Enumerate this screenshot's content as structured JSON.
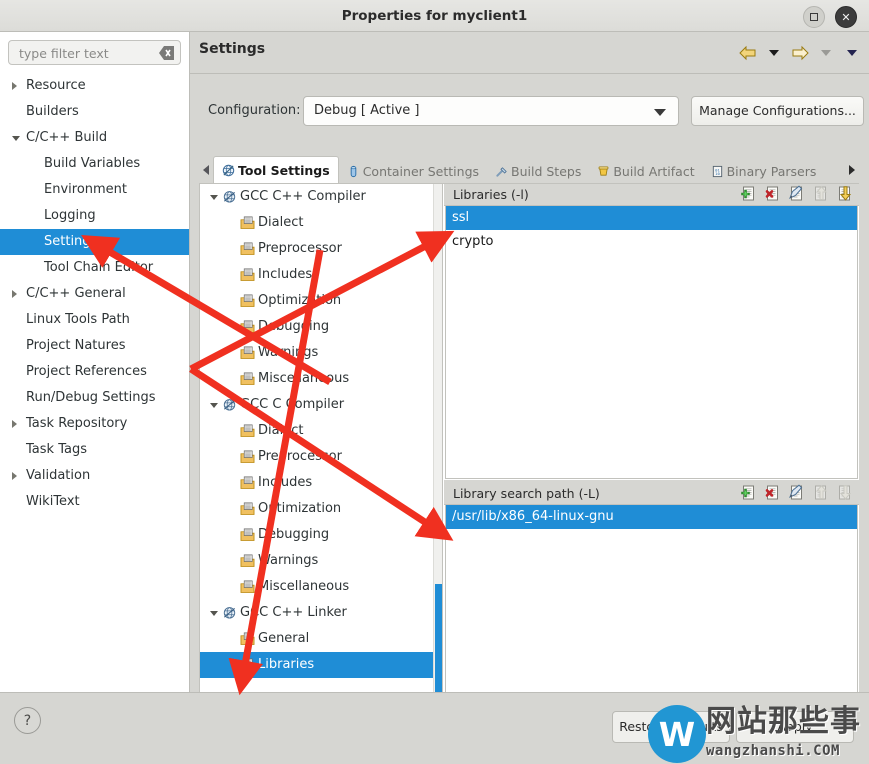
{
  "window": {
    "title": "Properties for myclient1",
    "maximize_label": "Maximize",
    "close_label": "Close"
  },
  "sidebar": {
    "filter": {
      "value": "",
      "placeholder": "type filter text",
      "clear_label": "Clear"
    },
    "items": [
      {
        "label": "Resource",
        "depth": 0,
        "twisty": "collapsed",
        "selected": false
      },
      {
        "label": "Builders",
        "depth": 0,
        "twisty": "none",
        "selected": false
      },
      {
        "label": "C/C++ Build",
        "depth": 0,
        "twisty": "expanded",
        "selected": false
      },
      {
        "label": "Build Variables",
        "depth": 1,
        "twisty": "none",
        "selected": false
      },
      {
        "label": "Environment",
        "depth": 1,
        "twisty": "none",
        "selected": false
      },
      {
        "label": "Logging",
        "depth": 1,
        "twisty": "none",
        "selected": false
      },
      {
        "label": "Settings",
        "depth": 1,
        "twisty": "none",
        "selected": true
      },
      {
        "label": "Tool Chain Editor",
        "depth": 1,
        "twisty": "none",
        "selected": false
      },
      {
        "label": "C/C++ General",
        "depth": 0,
        "twisty": "collapsed",
        "selected": false
      },
      {
        "label": "Linux Tools Path",
        "depth": 0,
        "twisty": "none",
        "selected": false
      },
      {
        "label": "Project Natures",
        "depth": 0,
        "twisty": "none",
        "selected": false
      },
      {
        "label": "Project References",
        "depth": 0,
        "twisty": "none",
        "selected": false
      },
      {
        "label": "Run/Debug Settings",
        "depth": 0,
        "twisty": "none",
        "selected": false
      },
      {
        "label": "Task Repository",
        "depth": 0,
        "twisty": "collapsed",
        "selected": false
      },
      {
        "label": "Task Tags",
        "depth": 0,
        "twisty": "none",
        "selected": false
      },
      {
        "label": "Validation",
        "depth": 0,
        "twisty": "collapsed",
        "selected": false
      },
      {
        "label": "WikiText",
        "depth": 0,
        "twisty": "none",
        "selected": false
      }
    ]
  },
  "page": {
    "title": "Settings",
    "nav": {
      "back_label": "Back",
      "back_menu_label": "Back history",
      "forward_label": "Forward",
      "forward_menu_label": "Forward history",
      "view_menu_label": "View menu"
    }
  },
  "configuration": {
    "label": "Configuration:",
    "value": "Debug  [ Active ]",
    "options": [
      "Debug  [ Active ]"
    ],
    "manage_button": "Manage Configurations..."
  },
  "tabs": {
    "scroll_left_label": "Scroll tabs left",
    "scroll_right_label": "Scroll tabs right",
    "items": [
      {
        "label": "Tool Settings",
        "icon": "tool-settings-icon",
        "active": true
      },
      {
        "label": "Container Settings",
        "icon": "container-icon",
        "active": false
      },
      {
        "label": "Build Steps",
        "icon": "build-steps-icon",
        "active": false
      },
      {
        "label": "Build Artifact",
        "icon": "build-artifact-icon",
        "active": false
      },
      {
        "label": "Binary Parsers",
        "icon": "binary-parsers-icon",
        "active": false
      }
    ]
  },
  "tool_tree": [
    {
      "label": "GCC C++ Compiler",
      "type": "tool",
      "twisty": "expanded",
      "selected": false
    },
    {
      "label": "Dialect",
      "type": "option",
      "twisty": "none",
      "selected": false
    },
    {
      "label": "Preprocessor",
      "type": "option",
      "twisty": "none",
      "selected": false
    },
    {
      "label": "Includes",
      "type": "option",
      "twisty": "none",
      "selected": false
    },
    {
      "label": "Optimization",
      "type": "option",
      "twisty": "none",
      "selected": false
    },
    {
      "label": "Debugging",
      "type": "option",
      "twisty": "none",
      "selected": false
    },
    {
      "label": "Warnings",
      "type": "option",
      "twisty": "none",
      "selected": false
    },
    {
      "label": "Miscellaneous",
      "type": "option",
      "twisty": "none",
      "selected": false
    },
    {
      "label": "GCC C Compiler",
      "type": "tool",
      "twisty": "expanded",
      "selected": false
    },
    {
      "label": "Dialect",
      "type": "option",
      "twisty": "none",
      "selected": false
    },
    {
      "label": "Preprocessor",
      "type": "option",
      "twisty": "none",
      "selected": false
    },
    {
      "label": "Includes",
      "type": "option",
      "twisty": "none",
      "selected": false
    },
    {
      "label": "Optimization",
      "type": "option",
      "twisty": "none",
      "selected": false
    },
    {
      "label": "Debugging",
      "type": "option",
      "twisty": "none",
      "selected": false
    },
    {
      "label": "Warnings",
      "type": "option",
      "twisty": "none",
      "selected": false
    },
    {
      "label": "Miscellaneous",
      "type": "option",
      "twisty": "none",
      "selected": false
    },
    {
      "label": "GCC C++ Linker",
      "type": "tool",
      "twisty": "expanded",
      "selected": false
    },
    {
      "label": "General",
      "type": "option",
      "twisty": "none",
      "selected": false
    },
    {
      "label": "Libraries",
      "type": "option",
      "twisty": "none",
      "selected": true
    }
  ],
  "libraries_panel": {
    "title": "Libraries (-l)",
    "tools": [
      {
        "name": "add-icon",
        "label": "Add"
      },
      {
        "name": "delete-icon",
        "label": "Delete"
      },
      {
        "name": "edit-icon",
        "label": "Edit"
      },
      {
        "name": "move-up-icon",
        "label": "Move Up",
        "disabled": true
      },
      {
        "name": "move-down-icon",
        "label": "Move Down"
      }
    ],
    "rows": [
      {
        "value": "ssl",
        "selected": true
      },
      {
        "value": "crypto",
        "selected": false
      }
    ]
  },
  "search_path_panel": {
    "title": "Library search path (-L)",
    "tools": [
      {
        "name": "add-icon",
        "label": "Add"
      },
      {
        "name": "delete-icon",
        "label": "Delete"
      },
      {
        "name": "edit-icon",
        "label": "Edit"
      },
      {
        "name": "move-up-icon",
        "label": "Move Up",
        "disabled": true
      },
      {
        "name": "move-down-icon",
        "label": "Move Down",
        "disabled": true
      }
    ],
    "rows": [
      {
        "value": "/usr/lib/x86_64-linux-gnu",
        "selected": true
      }
    ]
  },
  "footer": {
    "help_label": "?",
    "restore_defaults": "Restore Defaults",
    "apply": "Apply"
  },
  "watermark": {
    "badge": "W",
    "text_cn": "网站那些事",
    "url": "wangzhanshi.COM"
  },
  "colors": {
    "selection_blue": "#1f8dd6",
    "window_bg": "#d6d6d2",
    "panel_white": "#ffffff",
    "annotation_red": "#f03020",
    "watermark_blue": "#2196d3"
  }
}
